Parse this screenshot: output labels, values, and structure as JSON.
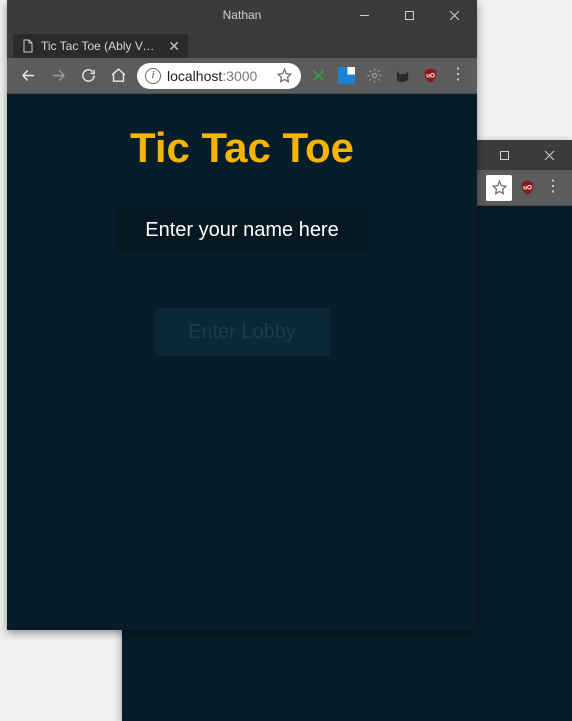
{
  "fg_window": {
    "titlebar": {
      "title": "Nathan"
    },
    "tab": {
      "label": "Tic Tac Toe (Ably Vue Tut"
    },
    "toolbar": {
      "url_host": "localhost",
      "url_port": ":3000"
    },
    "page": {
      "title": "Tic Tac Toe",
      "name_placeholder": "Enter your name here",
      "enter_lobby_label": "Enter Lobby"
    }
  },
  "bg_window": {}
}
